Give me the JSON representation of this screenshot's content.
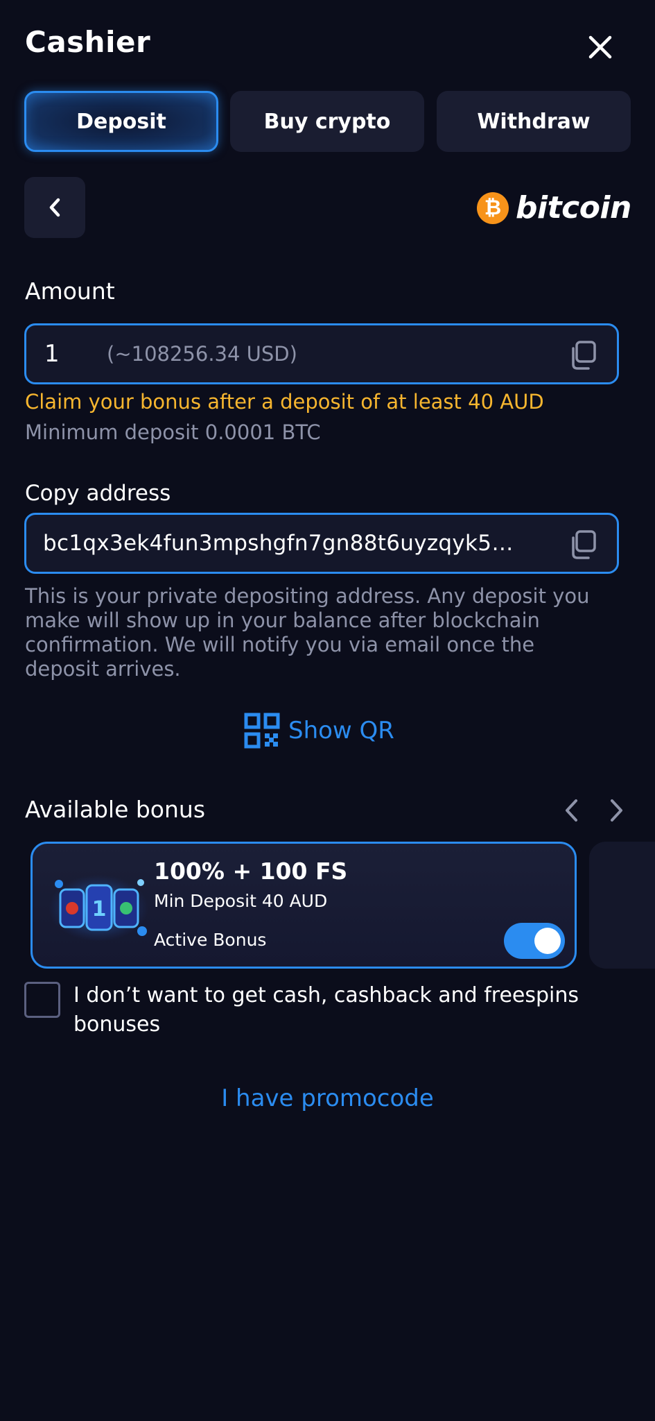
{
  "header": {
    "title": "Cashier",
    "close_icon": "close-icon"
  },
  "tabs": [
    {
      "label": "Deposit",
      "active": true
    },
    {
      "label": "Buy crypto",
      "active": false
    },
    {
      "label": "Withdraw",
      "active": false
    }
  ],
  "method": {
    "back_icon": "chevron-left-icon",
    "logo_text": "bitcoin",
    "logo_symbol": "₿",
    "brand_color": "#f7931a"
  },
  "amount": {
    "label": "Amount",
    "value": "1",
    "converted": "(~108256.34 USD)",
    "bonus_warning": "Claim your bonus after a deposit of at least 40 AUD",
    "min_deposit": "Minimum deposit 0.0001 BTC"
  },
  "address": {
    "label": "Copy address",
    "value": "bc1qx3ek4fun3mpshgfn7gn88t6uyzqyk5…",
    "info": "This is your private depositing address. Any deposit you make will show up in your balance after blockchain confirmation. We will notify you via email once the deposit arrives."
  },
  "qr": {
    "label": "Show QR",
    "icon": "qr-code-icon"
  },
  "bonus": {
    "label": "Available bonus",
    "card": {
      "title": "100% + 100 FS",
      "min_deposit": "Min Deposit  40 AUD",
      "status": "Active Bonus",
      "toggle_on": true
    },
    "opt_out": "I don’t want to get cash, cashback and freespins bonuses"
  },
  "promo": {
    "label": "I have promocode"
  },
  "colors": {
    "background": "#0b0d1b",
    "accent": "#2b8cf0",
    "warning": "#f7b62f",
    "muted": "#8e93a9",
    "surface": "#1a1d31"
  }
}
